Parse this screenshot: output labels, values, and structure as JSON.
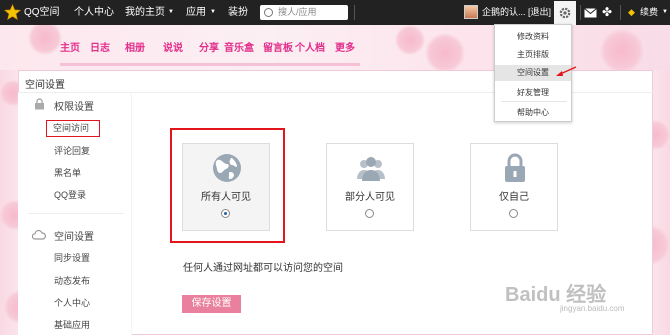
{
  "topbar": {
    "logo_label": "QQ空间",
    "nav": [
      "个人中心",
      "我的主页",
      "应用",
      "装扮"
    ],
    "search_placeholder": "搜人/应用",
    "username": "企鹅的认...",
    "logout": "[退出]",
    "vip_label": "续费"
  },
  "banner": {
    "nav": [
      "主页",
      "日志",
      "相册",
      "说说",
      "分享",
      "音乐盒",
      "留言板",
      "个人档",
      "更多"
    ]
  },
  "panel": {
    "title": "空间设置",
    "sections": [
      {
        "label": "权限设置",
        "items": [
          "空间访问",
          "评论回复",
          "黑名单",
          "QQ登录"
        ]
      },
      {
        "label": "空间设置",
        "items": [
          "同步设置",
          "动态发布",
          "个人中心",
          "基础应用"
        ]
      }
    ],
    "options": [
      {
        "label": "所有人可见",
        "selected": true
      },
      {
        "label": "部分人可见",
        "selected": false
      },
      {
        "label": "仅自己",
        "selected": false
      }
    ],
    "description": "任何人通过网址都可以访问您的空间",
    "save_label": "保存设置"
  },
  "dropdown": {
    "items": [
      "修改资料",
      "主页排版",
      "空间设置",
      "好友管理",
      "帮助中心"
    ],
    "highlighted": "空间设置"
  },
  "watermark": {
    "text": "Baidu 经验",
    "sub": "jingyan.baidu.com"
  },
  "colors": {
    "accent": "#e22f8b",
    "highlight_box": "#e2141c",
    "save_button": "#e9809d"
  }
}
